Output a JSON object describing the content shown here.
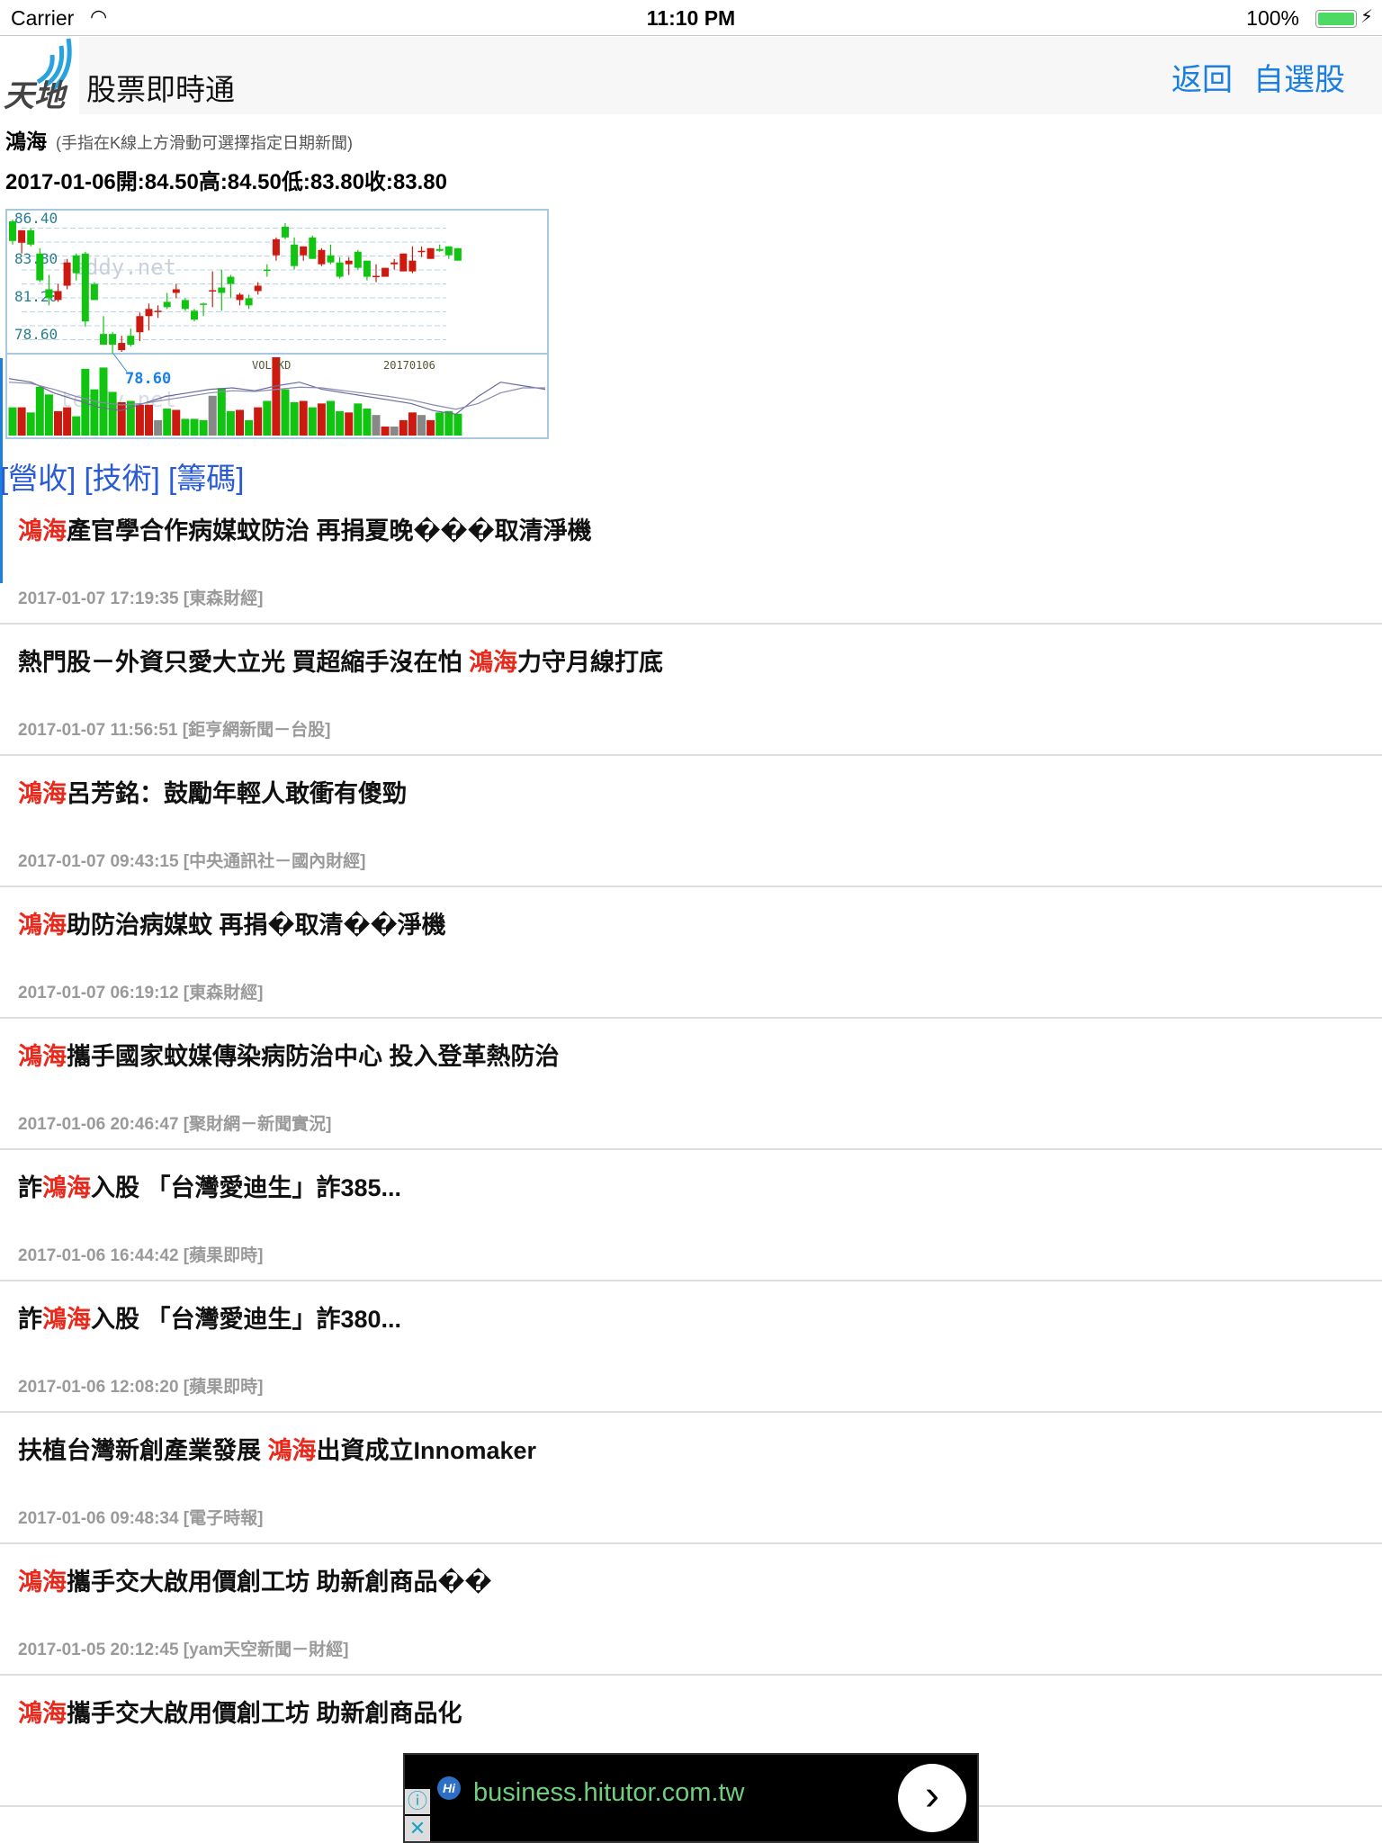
{
  "status": {
    "carrier": "Carrier",
    "time": "11:10 PM",
    "battery": "100%"
  },
  "nav": {
    "logo_text": "天地",
    "title": "股票即時通",
    "back": "返回",
    "watchlist": "自選股"
  },
  "stock": {
    "name": "鴻海",
    "hint": "(手指在K線上方滑動可選擇指定日期新聞)",
    "ohlc": "2017-01-06開:84.50高:84.50低:83.80收:83.80"
  },
  "links": [
    "[營收]",
    "[技術]",
    "[籌碼]"
  ],
  "news": [
    {
      "pre": "",
      "hl": "鴻海",
      "post": "產官學合作病媒蚊防治 再捐夏晚���取清淨機",
      "date": "2017-01-07 17:19:35 [東森財經]"
    },
    {
      "pre": "熱門股－外資只愛大立光 買超縮手沒在怕 ",
      "hl": "鴻海",
      "post": "力守月線打底",
      "date": "2017-01-07 11:56:51 [鉅亨網新聞－台股]"
    },
    {
      "pre": "",
      "hl": "鴻海",
      "post": "呂芳銘：鼓勵年輕人敢衝有傻勁",
      "date": "2017-01-07 09:43:15 [中央通訊社－國內財經]"
    },
    {
      "pre": "",
      "hl": "鴻海",
      "post": "助防治病媒蚊 再捐�取清��淨機",
      "date": "2017-01-07 06:19:12 [東森財經]"
    },
    {
      "pre": "",
      "hl": "鴻海",
      "post": "攜手國家蚊媒傳染病防治中心 投入登革熱防治",
      "date": "2017-01-06 20:46:47 [聚財網－新聞實況]"
    },
    {
      "pre": "詐",
      "hl": "鴻海",
      "post": "入股 「台灣愛迪生」詐385...",
      "date": "2017-01-06 16:44:42 [蘋果即時]"
    },
    {
      "pre": "詐",
      "hl": "鴻海",
      "post": "入股 「台灣愛迪生」詐380...",
      "date": "2017-01-06 12:08:20 [蘋果即時]"
    },
    {
      "pre": "扶植台灣新創產業發展 ",
      "hl": "鴻海",
      "post": "出資成立Innomaker",
      "date": "2017-01-06 09:48:34 [電子時報]"
    },
    {
      "pre": "",
      "hl": "鴻海",
      "post": "攜手交大啟用價創工坊 助新創商品��",
      "date": "2017-01-05 20:12:45 [yam天空新聞－財經]"
    },
    {
      "pre": "",
      "hl": "鴻海",
      "post": "攜手交大啟用價創工坊 助新創商品化",
      "date": ""
    }
  ],
  "ad": {
    "url": "business.hitutor.com.tw",
    "info": "ⓘ",
    "close": "✕",
    "go": "›",
    "brand": "Hi"
  },
  "chart_data": {
    "type": "candlestick",
    "y_ticks": [
      "86.40",
      "83.80",
      "81.20",
      "78.60"
    ],
    "ylim": [
      78.6,
      86.4
    ],
    "low_marker": "78.60",
    "volume_label": "VOL KD",
    "date_label": "20170106",
    "watermark": "teddy.net",
    "colors": {
      "up": "#cc1a10",
      "down": "#11c411",
      "flat": "#888888"
    },
    "candles": [
      [
        86.0,
        86.1,
        84.7,
        84.9
      ],
      [
        84.8,
        85.5,
        84.2,
        85.5
      ],
      [
        85.5,
        85.6,
        84.6,
        84.7
      ],
      [
        84.2,
        84.5,
        82.6,
        82.7
      ],
      [
        82.2,
        83.0,
        81.3,
        81.7
      ],
      [
        81.6,
        82.5,
        81.5,
        82.1
      ],
      [
        82.4,
        83.9,
        82.2,
        83.7
      ],
      [
        84.1,
        84.2,
        82.7,
        83.1
      ],
      [
        84.2,
        84.3,
        80.1,
        80.4
      ],
      [
        82.5,
        82.6,
        81.6,
        81.6
      ],
      [
        79.7,
        80.7,
        79.1,
        79.1
      ],
      [
        79.7,
        79.8,
        78.6,
        79.1
      ],
      [
        78.8,
        79.6,
        78.7,
        79.2
      ],
      [
        79.6,
        80.0,
        79.0,
        79.1
      ],
      [
        79.8,
        80.9,
        79.3,
        80.7
      ],
      [
        80.7,
        81.4,
        79.9,
        81.1
      ],
      [
        80.95,
        81.3,
        80.6,
        81.0
      ],
      [
        81.5,
        82.0,
        81.1,
        81.2
      ],
      [
        82.0,
        82.5,
        81.7,
        82.2
      ],
      [
        81.6,
        81.7,
        81.0,
        81.1
      ],
      [
        81.0,
        81.1,
        80.4,
        80.5
      ],
      [
        81.4,
        81.45,
        80.7,
        81.35
      ],
      [
        82.1,
        83.2,
        81.2,
        82.15
      ],
      [
        82.3,
        83.3,
        81.0,
        82.0
      ],
      [
        82.9,
        83.0,
        81.7,
        82.5
      ],
      [
        81.6,
        82.0,
        81.3,
        81.9
      ],
      [
        81.7,
        81.9,
        81.1,
        81.3
      ],
      [
        82.1,
        82.6,
        81.9,
        82.4
      ],
      [
        83.3,
        83.6,
        82.9,
        83.25
      ],
      [
        84.1,
        85.1,
        83.8,
        85.0
      ],
      [
        85.7,
        85.9,
        85.0,
        85.1
      ],
      [
        84.7,
        85.1,
        83.3,
        83.5
      ],
      [
        84.1,
        84.6,
        83.8,
        84.6
      ],
      [
        85.1,
        85.2,
        83.9,
        83.9
      ],
      [
        83.6,
        84.5,
        83.5,
        84.4
      ],
      [
        84.1,
        84.7,
        83.6,
        83.7
      ],
      [
        83.7,
        84.0,
        82.8,
        82.9
      ],
      [
        83.6,
        84.0,
        83.0,
        83.8
      ],
      [
        84.3,
        84.4,
        83.3,
        83.4
      ],
      [
        83.8,
        83.8,
        82.7,
        82.9
      ],
      [
        82.9,
        83.6,
        82.6,
        82.95
      ],
      [
        82.9,
        83.4,
        82.9,
        83.4
      ],
      [
        83.6,
        83.9,
        83.3,
        83.7
      ],
      [
        83.2,
        84.2,
        83.2,
        84.2
      ],
      [
        83.2,
        84.6,
        83.1,
        83.8
      ],
      [
        84.3,
        84.6,
        84.0,
        84.35
      ],
      [
        83.9,
        84.5,
        83.9,
        84.5
      ],
      [
        84.45,
        84.7,
        84.3,
        84.35
      ],
      [
        84.6,
        84.6,
        83.9,
        84.1
      ],
      [
        84.5,
        84.5,
        83.8,
        83.8
      ]
    ],
    "volume": [
      110,
      110,
      90,
      190,
      160,
      95,
      110,
      75,
      260,
      180,
      265,
      170,
      130,
      135,
      120,
      120,
      60,
      105,
      100,
      65,
      65,
      60,
      155,
      185,
      95,
      100,
      60,
      110,
      135,
      305,
      180,
      130,
      135,
      110,
      125,
      135,
      95,
      90,
      125,
      105,
      80,
      35,
      35,
      60,
      90,
      80,
      60,
      90,
      95,
      85
    ],
    "flat_volume_idx": [
      16,
      22,
      40,
      42,
      45
    ],
    "k": [
      75,
      70,
      55,
      45,
      35,
      30,
      40,
      50,
      55,
      60,
      62,
      58,
      65,
      70,
      60,
      55,
      50,
      45,
      40,
      30,
      25,
      50,
      70,
      65,
      60
    ],
    "d": [
      70,
      68,
      60,
      50,
      42,
      38,
      40,
      45,
      50,
      55,
      58,
      57,
      60,
      63,
      62,
      58,
      54,
      50,
      45,
      38,
      32,
      40,
      55,
      62,
      62
    ]
  }
}
